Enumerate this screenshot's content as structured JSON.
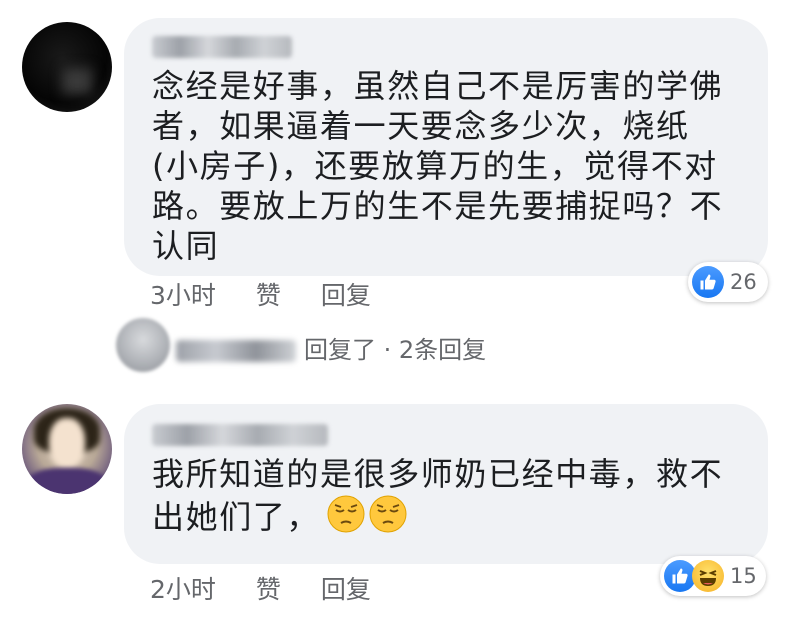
{
  "comments": [
    {
      "text": "念经是好事，虽然自己不是厉害的学佛\n者，如果逼着一天要念多少次，烧纸\n(小房子)，还要放算万的生，觉得不对\n路。要放上万的生不是先要捕捉吗？不\n认同",
      "time": "3小时",
      "like_label": "赞",
      "reply_label": "回复",
      "reaction_count": "26",
      "reactions": [
        "like-icon"
      ]
    },
    {
      "text": "我所知道的是很多师奶已经中毒，救不\n出她们了，",
      "emoji": [
        "pensive-face-icon",
        "pensive-face-icon"
      ],
      "time": "2小时",
      "like_label": "赞",
      "reply_label": "回复",
      "reaction_count": "15",
      "reactions": [
        "like-icon",
        "haha-icon"
      ]
    }
  ],
  "reply_thread": {
    "label": "回复了 · 2条回复"
  },
  "colors": {
    "bubble": "#f0f2f5",
    "text": "#1c1e21",
    "meta": "#65676b",
    "like_blue": "#1877f2",
    "haha_yellow": "#f7b125"
  }
}
